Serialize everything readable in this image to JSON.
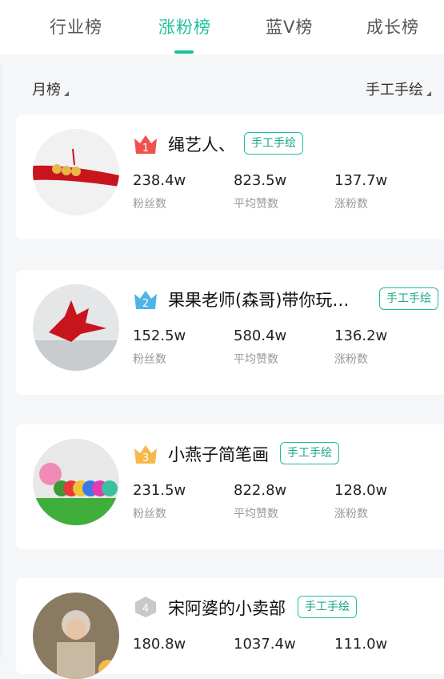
{
  "tabs": [
    "行业榜",
    "涨粉榜",
    "蓝V榜",
    "成长榜"
  ],
  "active_tab": "涨粉榜",
  "filters": {
    "period": "月榜",
    "category": "手工手绘"
  },
  "stat_labels": {
    "fans": "粉丝数",
    "avg_likes": "平均赞数",
    "growth": "涨粉数"
  },
  "cards": [
    {
      "rank": "1",
      "name": "绳艺人、",
      "tag": "手工手绘",
      "fans": "238.4w",
      "avg_likes": "823.5w",
      "growth": "137.7w"
    },
    {
      "rank": "2",
      "name": "果果老师(森哥)带你玩…",
      "tag": "手工手绘",
      "fans": "152.5w",
      "avg_likes": "580.4w",
      "growth": "136.2w"
    },
    {
      "rank": "3",
      "name": "小燕子简笔画",
      "tag": "手工手绘",
      "fans": "231.5w",
      "avg_likes": "822.8w",
      "growth": "128.0w"
    },
    {
      "rank": "4",
      "name": "宋阿婆的小卖部",
      "tag": "手工手绘",
      "fans": "180.8w",
      "avg_likes": "1037.4w",
      "growth": "111.0w"
    }
  ],
  "colors": {
    "accent": "#1fbf9c",
    "rank1": "#f0524b",
    "rank2": "#4fb3e8",
    "rank3": "#f5b94a",
    "rank4": "#c8c8c8"
  }
}
